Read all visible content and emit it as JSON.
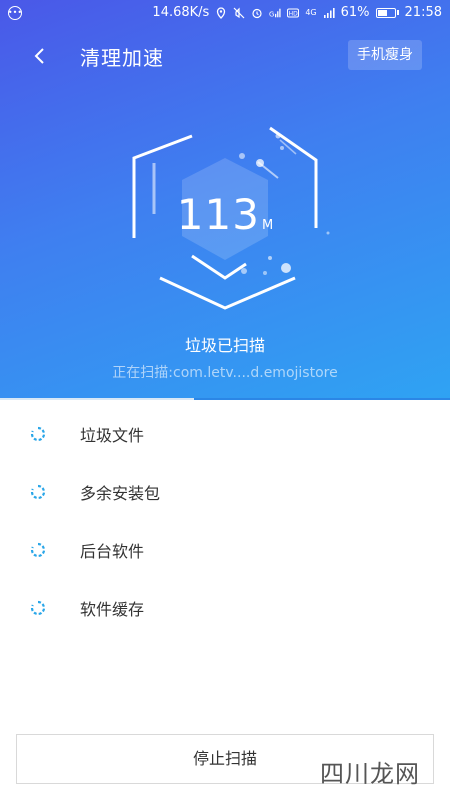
{
  "status_bar": {
    "speed": "14.68K/s",
    "network": "4G",
    "battery_text": "61%",
    "battery_level": 0.61,
    "time": "21:58",
    "icons": [
      "notification-icon",
      "location-icon",
      "mute-icon",
      "alarm-icon",
      "signal-icon",
      "hd-icon",
      "signal-4g-icon",
      "battery-icon"
    ]
  },
  "header": {
    "title": "清理加速",
    "action_label": "手机瘦身"
  },
  "scan": {
    "size_value": "113",
    "size_unit": "M",
    "status": "垃圾已扫描",
    "path": "正在扫描:com.letv....d.emojistore",
    "progress": 0.43
  },
  "list": {
    "items": [
      {
        "label": "垃圾文件",
        "icon": "loading-spinner-icon"
      },
      {
        "label": "多余安装包",
        "icon": "loading-spinner-icon"
      },
      {
        "label": "后台软件",
        "icon": "loading-spinner-icon"
      },
      {
        "label": "软件缓存",
        "icon": "loading-spinner-icon"
      }
    ]
  },
  "footer": {
    "stop_label": "停止扫描"
  },
  "watermark": "四川龙网",
  "colors": {
    "gradient_top": "#4a58e8",
    "gradient_bottom": "#2fa3f3",
    "spinner": "#29a6e8"
  }
}
